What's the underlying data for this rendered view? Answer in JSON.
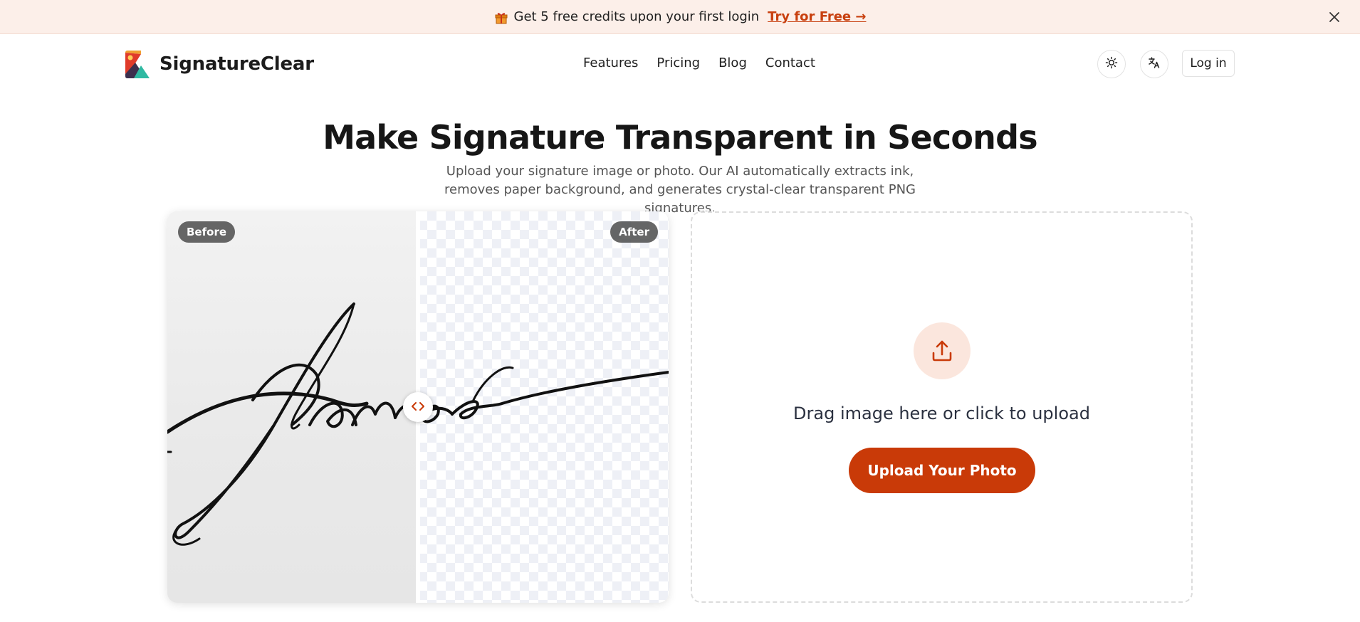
{
  "promo": {
    "text": "Get 5 free credits upon your first login",
    "cta": "Try for Free →",
    "icon": "gift-icon"
  },
  "brand": {
    "name": "SignatureClear"
  },
  "nav": {
    "items": [
      {
        "label": "Features"
      },
      {
        "label": "Pricing"
      },
      {
        "label": "Blog"
      },
      {
        "label": "Contact"
      }
    ]
  },
  "header_actions": {
    "theme_icon": "sun-icon",
    "language_icon": "translate-icon",
    "login_label": "Log in"
  },
  "hero": {
    "title": "Make Signature Transparent in Seconds",
    "subtitle": "Upload your signature image or photo. Our AI automatically extracts ink, removes paper background, and generates crystal-clear transparent PNG signatures."
  },
  "comparison": {
    "before_label": "Before",
    "after_label": "After",
    "handle_icon": "code-arrows-icon"
  },
  "upload": {
    "hint": "Drag image here or click to upload",
    "button_label": "Upload Your Photo",
    "icon": "upload-icon"
  },
  "colors": {
    "accent": "#c93a08",
    "accent_light": "#fbe6dd",
    "banner_bg": "#fcefe9"
  }
}
